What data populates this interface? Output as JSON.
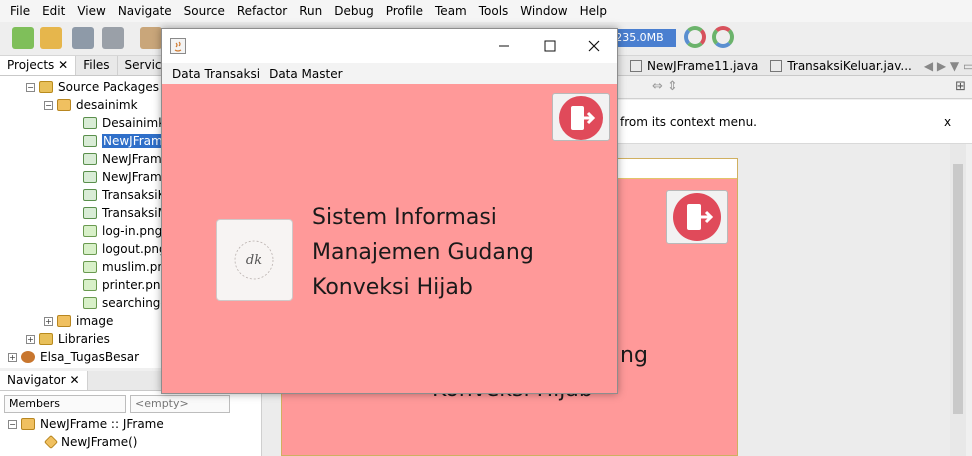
{
  "ide": {
    "menu": [
      "File",
      "Edit",
      "View",
      "Navigate",
      "Source",
      "Refactor",
      "Run",
      "Debug",
      "Profile",
      "Team",
      "Tools",
      "Window",
      "Help"
    ],
    "memory": "...7/235.0MB",
    "projects_tabs": [
      "Projects",
      "Files",
      "Servic"
    ],
    "tree": [
      {
        "label": "Source Packages"
      },
      {
        "label": "desainimk"
      },
      {
        "label": "Desainimk.ja"
      },
      {
        "label": "NewJFrame"
      },
      {
        "label": "NewJFrame"
      },
      {
        "label": "NewJFrame"
      },
      {
        "label": "TransaksiKe"
      },
      {
        "label": "TransaksiMa"
      },
      {
        "label": "log-in.png"
      },
      {
        "label": "logout.png"
      },
      {
        "label": "muslim.png"
      },
      {
        "label": "printer.png"
      },
      {
        "label": "searching-b"
      },
      {
        "label": "image"
      },
      {
        "label": "Libraries"
      },
      {
        "label": "Elsa_TugasBesar"
      }
    ],
    "navigator": {
      "tab": "Navigator",
      "members": "Members",
      "filter": "<empty>",
      "rows": [
        {
          "label": "NewJFrame :: JFrame"
        },
        {
          "label": "NewJFrame()"
        }
      ]
    },
    "editor_tabs": [
      "NewJFrame11.java",
      "TransaksiKeluar.jav..."
    ],
    "info_bar_text": "from its context menu.",
    "info_bar_close": "x",
    "design_behind_lines": [
      "ng",
      "Konveksi Hijab"
    ]
  },
  "app_window": {
    "menu": [
      "Data Transaksi",
      "Data Master"
    ],
    "title_lines": [
      "Sistem Informasi",
      "Manajemen Gudang",
      "Konveksi Hijab"
    ],
    "logo_text": "dk",
    "colors": {
      "background": "#ff9999",
      "exit_icon": "#e04a5a"
    }
  }
}
